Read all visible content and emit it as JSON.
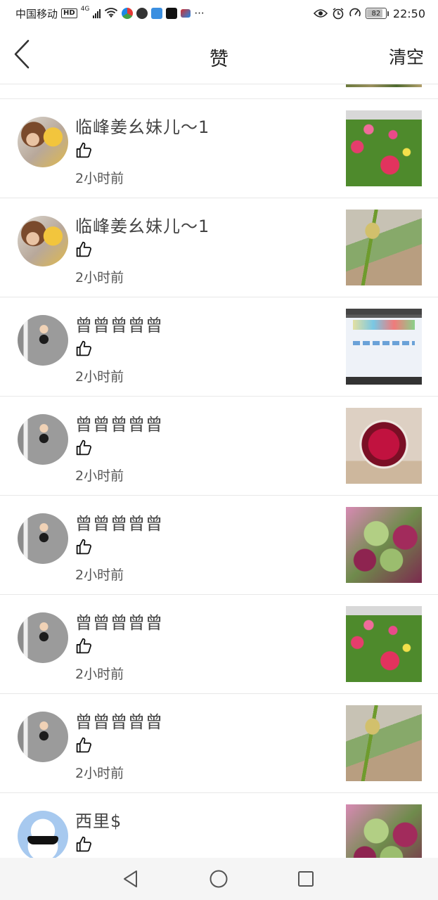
{
  "status_bar": {
    "carrier": "中国移动",
    "hd": "HD",
    "network": "4G",
    "battery": "82",
    "time": "22:50",
    "more": "···",
    "icons": [
      "hd-icon",
      "signal-icon",
      "wifi-icon",
      "browser-icon",
      "chat-icon",
      "news-icon",
      "tiktok-icon",
      "mail-icon",
      "eye-icon",
      "alarm-icon",
      "speedometer-icon",
      "battery-icon"
    ]
  },
  "header": {
    "title": "赞",
    "clear_label": "清空",
    "back_icon": "chevron-left-icon"
  },
  "likes": [
    {
      "user": "临峰姜幺妹儿～1",
      "time": "2小时前",
      "avatar": "avatar-girl",
      "thumb": "photo-roses"
    },
    {
      "user": "临峰姜幺妹儿～1",
      "time": "2小时前",
      "avatar": "avatar-girl",
      "thumb": "photo-spike-flower"
    },
    {
      "user": "曾曾曾曾曾",
      "time": "2小时前",
      "avatar": "avatar-boy",
      "thumb": "photo-screen"
    },
    {
      "user": "曾曾曾曾曾",
      "time": "2小时前",
      "avatar": "avatar-boy",
      "thumb": "photo-red-chair"
    },
    {
      "user": "曾曾曾曾曾",
      "time": "2小时前",
      "avatar": "avatar-boy",
      "thumb": "photo-succulents"
    },
    {
      "user": "曾曾曾曾曾",
      "time": "2小时前",
      "avatar": "avatar-boy",
      "thumb": "photo-roses"
    },
    {
      "user": "曾曾曾曾曾",
      "time": "2小时前",
      "avatar": "avatar-boy",
      "thumb": "photo-spike-flower"
    },
    {
      "user": "西里$",
      "time": "",
      "avatar": "avatar-cloud",
      "thumb": "photo-succulents"
    }
  ],
  "nav": {
    "icons": [
      "back-triangle-icon",
      "home-circle-icon",
      "recents-square-icon"
    ]
  },
  "colors": {
    "divider": "#e8e8e8",
    "text": "#444444",
    "nav_bg": "#f5f5f5"
  }
}
